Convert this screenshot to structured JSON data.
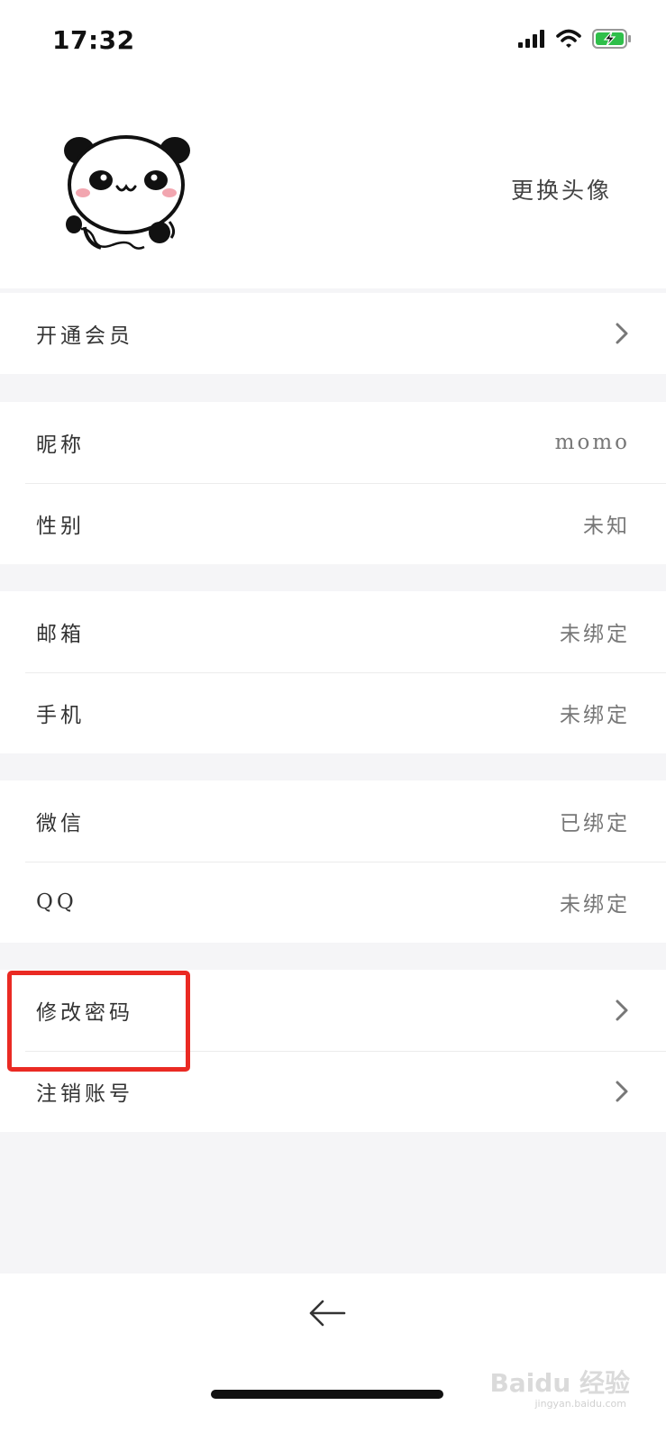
{
  "status_bar": {
    "time": "17:32",
    "signal_icon": "cellular-signal-icon",
    "wifi_icon": "wifi-icon",
    "battery_icon": "battery-charging-icon",
    "battery_color": "#2fbf4a"
  },
  "profile": {
    "avatar_icon": "panda-avatar-icon",
    "change_avatar_label": "更换头像"
  },
  "sections": {
    "membership": {
      "label": "开通会员"
    },
    "nickname": {
      "label": "昵称",
      "value": "momo"
    },
    "gender": {
      "label": "性别",
      "value": "未知"
    },
    "email": {
      "label": "邮箱",
      "value": "未绑定"
    },
    "phone": {
      "label": "手机",
      "value": "未绑定"
    },
    "wechat": {
      "label": "微信",
      "value": "已绑定"
    },
    "qq": {
      "label": "QQ",
      "value": "未绑定"
    },
    "change_password": {
      "label": "修改密码"
    },
    "delete_account": {
      "label": "注销账号"
    }
  },
  "highlight_color": "#ea2a23",
  "navigation": {
    "back_icon": "back-arrow-icon"
  },
  "watermark": {
    "text": "Baidu 经验",
    "sub": "jingyan.baidu.com"
  }
}
